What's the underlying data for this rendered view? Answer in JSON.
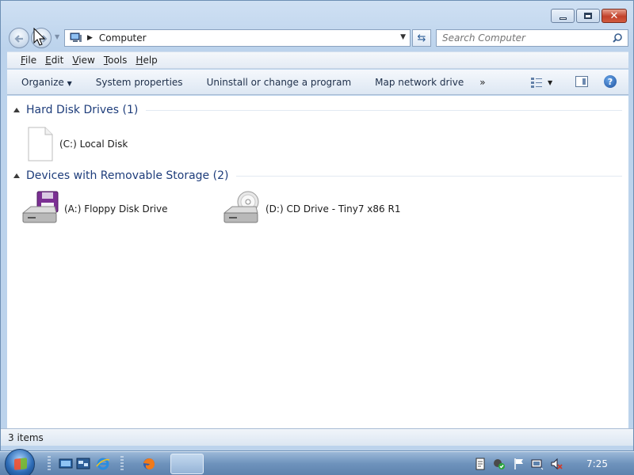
{
  "window": {
    "caption_buttons": {
      "minimize_icon": "minimize-icon",
      "maximize_icon": "maximize-icon",
      "close_icon": "close-icon",
      "close_glyph": "✕"
    }
  },
  "nav": {
    "address": {
      "path_root": "Computer",
      "separator": "▶",
      "dropdown": "▼"
    },
    "refresh_glyph": "⇆",
    "search": {
      "placeholder": "Search Computer"
    }
  },
  "menu": {
    "items": [
      {
        "label": "File",
        "underline": "F",
        "rest": "ile"
      },
      {
        "label": "Edit",
        "underline": "E",
        "rest": "dit"
      },
      {
        "label": "View",
        "underline": "V",
        "rest": "iew"
      },
      {
        "label": "Tools",
        "underline": "T",
        "rest": "ools"
      },
      {
        "label": "Help",
        "underline": "H",
        "rest": "elp"
      }
    ]
  },
  "commandbar": {
    "organize": "Organize",
    "organize_arrow": "▼",
    "system_properties": "System properties",
    "uninstall": "Uninstall or change a program",
    "map_drive": "Map network drive",
    "more": "»",
    "views_arrow": "▼",
    "help_glyph": "?"
  },
  "groups": [
    {
      "title": "Hard Disk Drives (1)",
      "items": [
        {
          "label": "(C:) Local Disk",
          "icon": "blank-document-icon"
        }
      ]
    },
    {
      "title": "Devices with Removable Storage (2)",
      "items": [
        {
          "label": "(A:) Floppy Disk Drive",
          "icon": "floppy-drive-icon"
        },
        {
          "label": "(D:) CD Drive - Tiny7 x86 R1",
          "icon": "cd-drive-icon"
        }
      ]
    }
  ],
  "status": {
    "text": "3 items"
  },
  "taskbar": {
    "clock": "7:25",
    "colors": {
      "accent": "#1e3d7b",
      "taskbar": "#6f93bc",
      "close": "#c2412a"
    }
  }
}
